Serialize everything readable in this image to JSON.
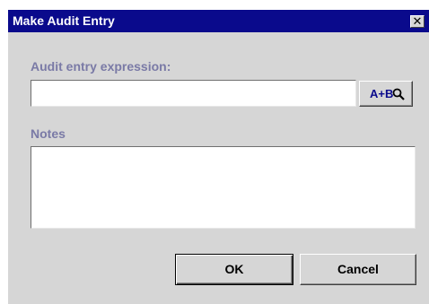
{
  "window": {
    "title": "Make Audit Entry",
    "close_glyph": "✕"
  },
  "expression": {
    "label": "Audit entry expression:",
    "value": "",
    "builder_button_label": "A+B",
    "builder_button_icon": "magnifier-icon"
  },
  "notes": {
    "label": "Notes",
    "value": ""
  },
  "buttons": {
    "ok_label": "OK",
    "cancel_label": "Cancel"
  },
  "colors": {
    "titlebar": "#0a0a8c",
    "dialog_bg": "#d6d6d6",
    "label_text": "#7a7aa6"
  }
}
